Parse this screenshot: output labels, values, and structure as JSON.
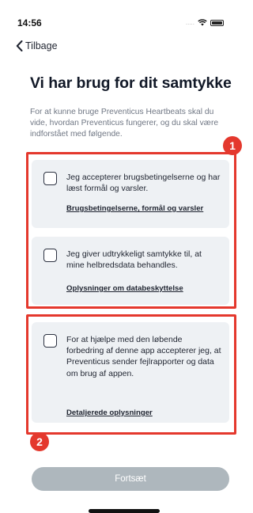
{
  "status_bar": {
    "time": "14:56",
    "signal": "....."
  },
  "nav": {
    "back_label": "Tilbage"
  },
  "page": {
    "title": "Vi har brug for dit samtykke",
    "intro": "For at kunne bruge Preventicus Heartbeats skal du vide, hvordan Preventicus fungerer, og du skal være indforstået med følgende."
  },
  "consents": [
    {
      "text": "Jeg accepterer brugsbetingelserne og har læst formål og varsler.",
      "link": "Brugsbetingelserne, formål og varsler",
      "checked": false
    },
    {
      "text": "Jeg giver udtrykkeligt samtykke til, at mine helbredsdata behandles.",
      "link": "Oplysninger om databeskyttelse",
      "checked": false
    },
    {
      "text": "For at hjælpe med den løbende forbedring af denne app accepterer jeg, at Preventicus sender fejlrapporter og data om brug af appen.",
      "link": "Detaljerede oplysninger",
      "checked": false
    }
  ],
  "annotations": [
    {
      "label": "1",
      "color": "#e4382d"
    },
    {
      "label": "2",
      "color": "#e4382d"
    }
  ],
  "continue_button": {
    "label": "Fortsæt",
    "enabled": false
  }
}
